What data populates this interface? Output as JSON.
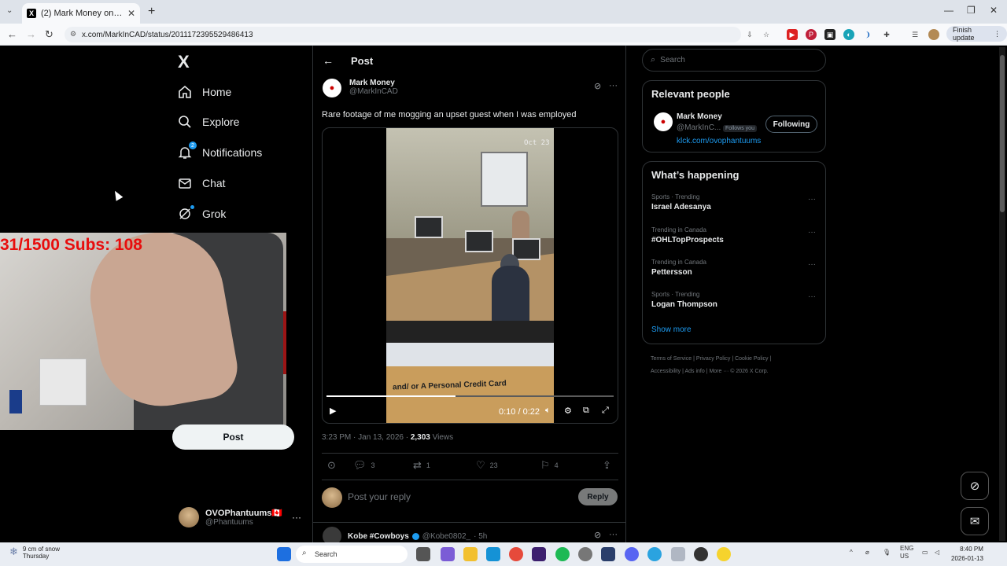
{
  "browser": {
    "tab_title": "(2) Mark Money on X: \"Rare fo",
    "tab_favicon": "X",
    "url": "x.com/MarkInCAD/status/2011172395529486413",
    "finish_update": "Finish update"
  },
  "nav": {
    "logo": "X",
    "items": [
      {
        "label": "Home",
        "icon": "home-icon"
      },
      {
        "label": "Explore",
        "icon": "search-icon"
      },
      {
        "label": "Notifications",
        "icon": "bell-icon",
        "badge": "2"
      },
      {
        "label": "Chat",
        "icon": "mail-icon"
      },
      {
        "label": "Grok",
        "icon": "grok-icon"
      }
    ],
    "post_button": "Post",
    "account": {
      "name": "OVOPhantuums🇨🇦",
      "handle": "@Phantuums"
    }
  },
  "webcam": {
    "overlay_text": "31/1500  Subs: 108"
  },
  "post": {
    "header": "Post",
    "author_name": "Mark Money",
    "author_handle": "@MarkInCAD",
    "text": "Rare footage of me mogging an upset guest when I was employed",
    "video": {
      "date_stamp": "Oct 23",
      "sign_text": "and/ or A Personal Credit Card",
      "time": "0:10 / 0:22",
      "progress": 0.45
    },
    "timestamp": "3:23 PM · Jan 13, 2026 · ",
    "views_count": "2,303",
    "views_label": " Views",
    "replies": "3",
    "reposts": "1",
    "likes": "23",
    "bookmarks": "4",
    "reply_placeholder": "Post your reply",
    "reply_button": "Reply"
  },
  "next_post": {
    "name": "Kobe #Cowboys",
    "handle": "@Kobe0802_",
    "time": "· 5h"
  },
  "sidebar": {
    "search_placeholder": "Search",
    "relevant_title": "Relevant people",
    "relevant": {
      "name": "Mark Money",
      "handle": "@MarkInC...",
      "follows_you": "Follows you",
      "link": "klck.com/ovophantuums",
      "button": "Following"
    },
    "happening_title": "What’s happening",
    "trends": [
      {
        "context": "Sports · Trending",
        "topic": "Israel Adesanya"
      },
      {
        "context": "Trending in Canada",
        "topic": "#OHLTopProspects"
      },
      {
        "context": "Trending in Canada",
        "topic": "Pettersson"
      },
      {
        "context": "Sports · Trending",
        "topic": "Logan Thompson"
      }
    ],
    "show_more": "Show more",
    "footer_line1": "Terms of Service  |  Privacy Policy  |  Cookie Policy  |",
    "footer_line2": "Accessibility  |  Ads info  |  More ···  © 2026 X Corp."
  },
  "taskbar": {
    "weather_temp": "9 cm of snow",
    "weather_day": "Thursday",
    "search": "Search",
    "lang1": "ENG",
    "lang2": "US",
    "time": "8:40 PM",
    "date": "2026-01-13"
  }
}
